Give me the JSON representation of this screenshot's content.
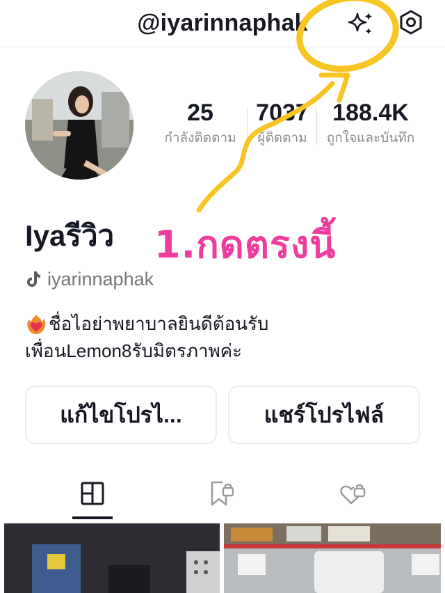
{
  "header": {
    "username": "@iyarinnaphak"
  },
  "profile": {
    "display_name": "Iyaรีวิว",
    "handle": "iyarinnaphak",
    "bio_lines": [
      "ชื่อไอย่าพยาบาลยินดีต้อนรับ",
      "เพื่อนLemon8รับมิตรภาพค่ะ"
    ]
  },
  "stats": [
    {
      "value": "25",
      "label": "กำลังติดตาม"
    },
    {
      "value": "7037",
      "label": "ผู้ติดตาม"
    },
    {
      "value": "188.4K",
      "label": "ถูกใจและบันทึก"
    }
  ],
  "buttons": {
    "edit_label": "แก้ไขโปรไ...",
    "share_label": "แชร์โปรไฟล์"
  },
  "annotation": {
    "text": "1.กดตรงนี้",
    "text_color": "#ee3d9e",
    "marker_color": "#f7c524"
  },
  "icons": {
    "sparkle": "sparkle-icon",
    "settings": "settings-icon",
    "handle": "tiktok-icon",
    "bio_emoji": "heart-on-fire-icon",
    "tab_posts": "grid-icon",
    "tab_saved": "bookmark-lock-icon",
    "tab_liked": "heart-lock-icon"
  }
}
